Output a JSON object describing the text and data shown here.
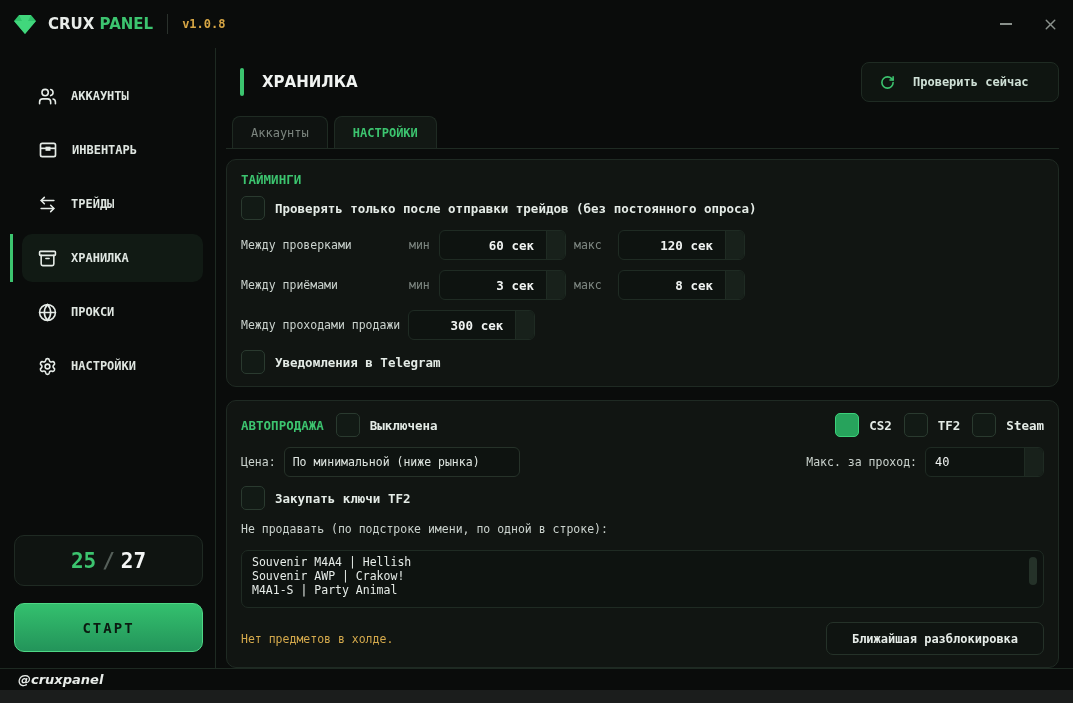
{
  "app": {
    "logo_word1": "CRUX",
    "logo_word2": "PANEL",
    "version": "v1.0.8"
  },
  "sidebar": {
    "items": [
      {
        "label": "АККАУНТЫ",
        "selected": false
      },
      {
        "label": "ИНВЕНТАРЬ",
        "selected": false
      },
      {
        "label": "ТРЕЙДЫ",
        "selected": false
      },
      {
        "label": "ХРАНИЛКА",
        "selected": true
      },
      {
        "label": "ПРОКСИ",
        "selected": false
      },
      {
        "label": "НАСТРОЙКИ",
        "selected": false
      }
    ],
    "counter": {
      "current": "25",
      "separator": "/",
      "total": "27"
    },
    "start_button": "СТАРТ"
  },
  "page": {
    "title": "ХРАНИЛКА",
    "check_button": "Проверить сейчас",
    "tabs": [
      {
        "label": "Аккаунты",
        "selected": false
      },
      {
        "label": "НАСТРОЙКИ",
        "selected": true
      }
    ]
  },
  "timings": {
    "title": "ТАЙМИНГИ",
    "only_after_trades": {
      "label": "Проверять только после отправки трейдов (без постоянного опроса)",
      "checked": false
    },
    "rows": [
      {
        "kind": "range",
        "label": "Между проверками",
        "min_label": "мин",
        "min": "60 сек",
        "max_label": "макс",
        "max": "120 сек"
      },
      {
        "kind": "range",
        "label": "Между приёмами",
        "min_label": "мин",
        "min": "3 сек",
        "max_label": "макс",
        "max": "8 сек"
      },
      {
        "kind": "single",
        "label": "Между проходами продажи",
        "value": "300 сек"
      }
    ],
    "telegram": {
      "label": "Уведомления в Telegram",
      "checked": false
    }
  },
  "autosell": {
    "title": "АВТОПРОДАЖА",
    "enabled": {
      "label": "Выключена",
      "checked": false
    },
    "games": [
      {
        "label": "CS2",
        "checked": true
      },
      {
        "label": "TF2",
        "checked": false
      },
      {
        "label": "Steam",
        "checked": false
      }
    ],
    "price_label": "Цена:",
    "price_value": "По минимальной (ниже рынка)",
    "max_label": "Макс. за проход:",
    "max_value": "40",
    "buy_keys": {
      "label": "Закупать ключи TF2",
      "checked": false
    },
    "exclude_label": "Не продавать (по подстроке имени, по одной в строке):",
    "exclude_lines": [
      "Souvenir M4A4 | Hellish",
      "Souvenir AWP | Crakow!",
      "M4A1-S | Party Animal"
    ],
    "hold_message": "Нет предметов в холде.",
    "unlock_button": "Ближайшая разблокировка"
  },
  "footer": {
    "handle": "@cruxpanel"
  }
}
